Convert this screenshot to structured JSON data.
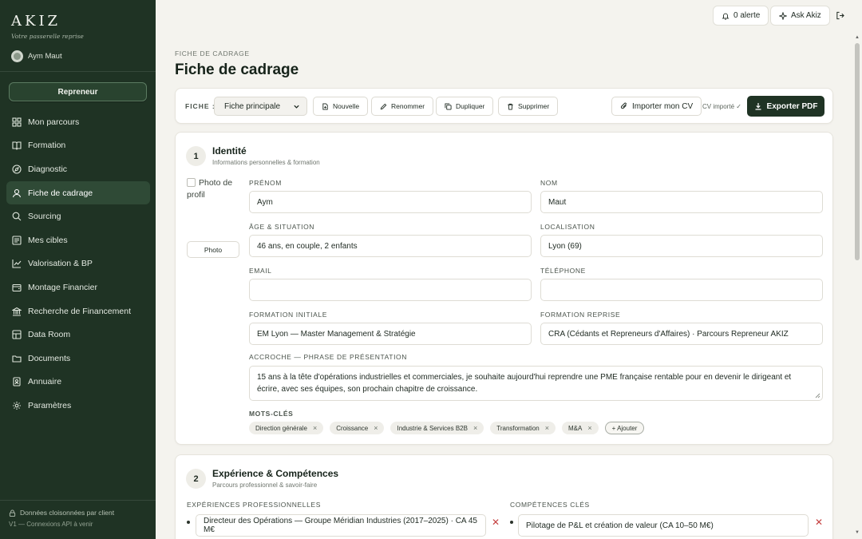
{
  "sidebar": {
    "brand": "AKIZ",
    "tagline": "Votre passerelle reprise",
    "user_name": "Aym Maut",
    "role_button": "Repreneur",
    "items": [
      {
        "label": "Mon parcours",
        "icon": "grid-icon"
      },
      {
        "label": "Formation",
        "icon": "book-icon"
      },
      {
        "label": "Diagnostic",
        "icon": "compass-icon"
      },
      {
        "label": "Fiche de cadrage",
        "icon": "user-icon",
        "active": true
      },
      {
        "label": "Sourcing",
        "icon": "search-icon"
      },
      {
        "label": "Mes cibles",
        "icon": "target-list-icon"
      },
      {
        "label": "Valorisation & BP",
        "icon": "line-chart-icon"
      },
      {
        "label": "Montage Financier",
        "icon": "wallet-icon"
      },
      {
        "label": "Recherche de Financement",
        "icon": "bank-icon"
      },
      {
        "label": "Data Room",
        "icon": "database-icon"
      },
      {
        "label": "Documents",
        "icon": "folder-icon"
      },
      {
        "label": "Annuaire",
        "icon": "contacts-icon"
      },
      {
        "label": "Paramètres",
        "icon": "gear-icon"
      }
    ],
    "footer_line1": "Données cloisonnées par client",
    "footer_line2": "V1 — Connexions API à venir"
  },
  "topbar": {
    "alerts": "0 alerte",
    "ask": "Ask Akiz"
  },
  "page": {
    "breadcrumb": "FICHE DE CADRAGE",
    "title": "Fiche de cadrage"
  },
  "toolbar": {
    "label": "FICHE :",
    "selected": "Fiche principale",
    "new": "Nouvelle",
    "rename": "Renommer",
    "duplicate": "Dupliquer",
    "delete": "Supprimer",
    "import_cv": "Importer mon CV",
    "cv_status": "CV importé ✓",
    "export": "Exporter PDF"
  },
  "identity": {
    "number": "1",
    "title": "Identité",
    "subtitle": "Informations personnelles & formation",
    "photo_alt": "Photo de profil",
    "photo_button": "Photo",
    "fields": {
      "prenom_label": "PRÉNOM",
      "prenom_value": "Aym",
      "nom_label": "NOM",
      "nom_value": "Maut",
      "age_label": "ÂGE & SITUATION",
      "age_value": "46 ans, en couple, 2 enfants",
      "loc_label": "LOCALISATION",
      "loc_value": "Lyon (69)",
      "email_label": "EMAIL",
      "email_value": "",
      "tel_label": "TÉLÉPHONE",
      "tel_value": "",
      "fi_label": "FORMATION INITIALE",
      "fi_value": "EM Lyon — Master Management & Stratégie",
      "fr_label": "FORMATION REPRISE",
      "fr_value": "CRA (Cédants et Repreneurs d'Affaires) · Parcours Repreneur AKIZ",
      "pitch_label": "ACCROCHE — PHRASE DE PRÉSENTATION",
      "pitch_value": "15 ans à la tête d'opérations industrielles et commerciales, je souhaite aujourd'hui reprendre une PME française rentable pour en devenir le dirigeant et écrire, avec ses équipes, son prochain chapitre de croissance.",
      "keywords_label": "MOTS-CLÉS"
    },
    "keywords": [
      "Direction générale",
      "Croissance",
      "Industrie & Services B2B",
      "Transformation",
      "M&A"
    ],
    "add_keyword": "+ Ajouter"
  },
  "experience": {
    "number": "2",
    "title": "Expérience & Compétences",
    "subtitle": "Parcours professionnel & savoir-faire",
    "exp_label": "EXPÉRIENCES PROFESSIONNELLES",
    "exp_value": "Directeur des Opérations — Groupe Méridian Industries (2017–2025) · CA 45 M€",
    "skills_label": "COMPÉTENCES CLÉS",
    "skill_value": "Pilotage de P&L et création de valeur (CA 10–50 M€)"
  }
}
